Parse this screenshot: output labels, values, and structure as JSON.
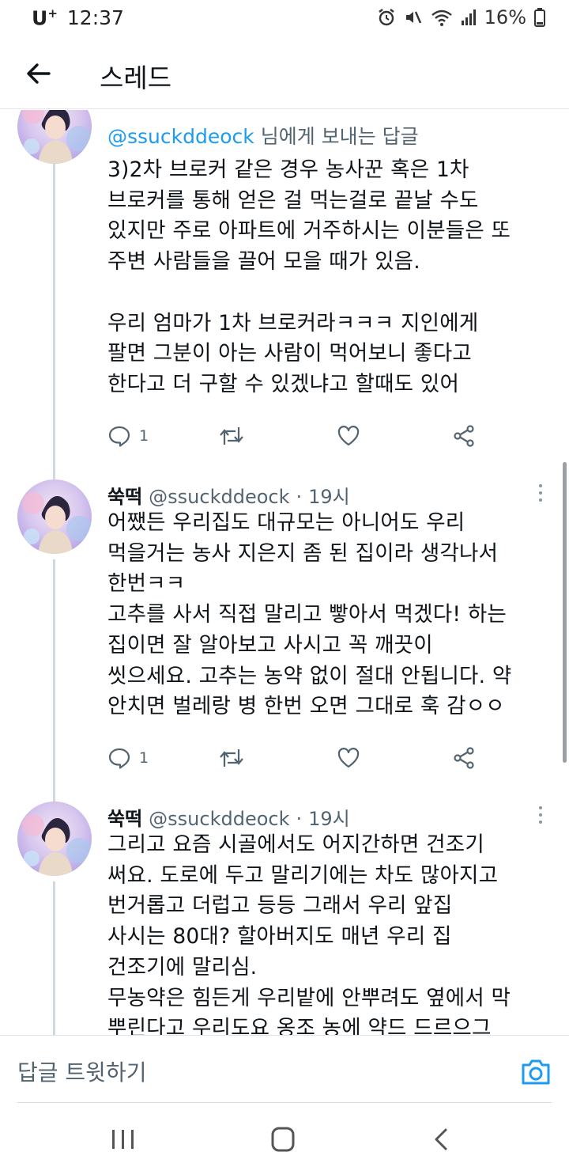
{
  "status_bar": {
    "carrier": "U",
    "carrier_mark": "+",
    "time": "12:37",
    "battery": "16%",
    "icons": [
      "alarm-icon",
      "mute-icon",
      "wifi-icon",
      "signal-icon",
      "battery-icon"
    ]
  },
  "header": {
    "title": "스레드",
    "back_icon": "back-arrow-icon"
  },
  "tweets": [
    {
      "reply_to_handle": "@ssuckddeock",
      "reply_to_suffix": "님에게 보내는 답글",
      "text": "3)2차 브로커 같은 경우 농사꾼 혹은 1차\n브로커를 통해 얻은 걸 먹는걸로 끝날 수도\n있지만 주로 아파트에 거주하시는 이분들은 또\n주변 사람들을 끌어 모을 때가 있음.\n\n우리 엄마가 1차 브로커라ㅋㅋㅋ 지인에게\n팔면 그분이 아는 사람이 먹어보니 좋다고\n한다고 더 구할 수 있겠냐고 할때도 있어",
      "reply_count": "1"
    },
    {
      "name": "쑥떡",
      "handle": "@ssuckddeock",
      "dot": "·",
      "time": "19시",
      "text": "어쨌든 우리집도 대규모는 아니어도 우리\n먹을거는 농사 지은지 좀 된 집이라 생각나서\n한번ㅋㅋ\n고추를 사서 직접 말리고 빻아서 먹겠다! 하는\n집이면 잘 알아보고 사시고 꼭 깨끗이\n씻으세요. 고추는 농약 없이 절대 안됩니다. 약\n안치면 벌레랑 병 한번 오면 그대로 훅 감ㅇㅇ",
      "reply_count": "1"
    },
    {
      "name": "쑥떡",
      "handle": "@ssuckddeock",
      "dot": "·",
      "time": "19시",
      "text": "그리고 요즘 시골에서도 어지간하면 건조기\n써요. 도로에 두고 말리기에는 차도 많아지고\n번거롭고 더럽고 등등 그래서 우리 앞집\n사시는 80대? 할아버지도 매년 우리 집\n건조기에 말리심.\n무농약은 힘든게 우리밭에 안뿌려도 옆에서 막\n뿌린다고 우리도요 옹조 농에 약드 드르으그"
    }
  ],
  "composer": {
    "placeholder": "답글 트윗하기",
    "camera_icon": "camera-icon"
  },
  "nav_bar": {
    "icons": [
      "recent-apps-icon",
      "home-icon",
      "back-icon"
    ]
  },
  "colors": {
    "accent": "#1d9bf0",
    "text": "#0f1419",
    "secondary": "#536471",
    "thread_line": "#cfd9de"
  }
}
